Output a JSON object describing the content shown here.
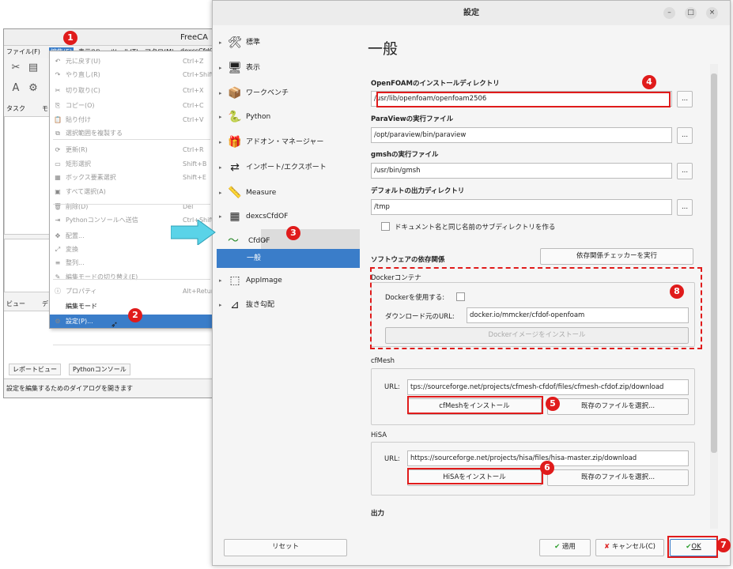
{
  "freecad": {
    "title": "FreeCA",
    "menubar": [
      "ファイル(F)",
      "編集(E)",
      "表示(V)",
      "ツール(T)",
      "マクロ(M)",
      "dexcsCfdO"
    ],
    "tabs_top": [
      "タスク",
      "モ"
    ],
    "bottom_tabs": [
      "レポートビュー",
      "Pythonコンソール"
    ],
    "left_tabs": [
      "ビュー",
      "デ"
    ],
    "status": "設定を編集するためのダイアログを開きます"
  },
  "edit_menu": {
    "items": [
      {
        "label": "元に戻す(U)",
        "shortcut": "Ctrl+Z",
        "icon": "↶"
      },
      {
        "label": "やり直し(R)",
        "shortcut": "Ctrl+Shift",
        "icon": "↷"
      },
      {
        "label": "切り取り(C)",
        "shortcut": "Ctrl+X",
        "icon": "✂"
      },
      {
        "label": "コピー(O)",
        "shortcut": "Ctrl+C",
        "icon": "⎘"
      },
      {
        "label": "貼り付け",
        "shortcut": "Ctrl+V",
        "icon": "📋"
      },
      {
        "label": "選択範囲を複製する",
        "shortcut": "",
        "icon": "⧉"
      },
      {
        "label": "更新(R)",
        "shortcut": "Ctrl+R",
        "icon": "⟳"
      },
      {
        "label": "矩形選択",
        "shortcut": "Shift+B",
        "icon": "▭"
      },
      {
        "label": "ボックス要素選択",
        "shortcut": "Shift+E",
        "icon": "▦"
      },
      {
        "label": "すべて選択(A)",
        "shortcut": "",
        "icon": "▣"
      },
      {
        "label": "削除(D)",
        "shortcut": "Del",
        "icon": "🗑"
      },
      {
        "label": "Pythonコンソールへ送信",
        "shortcut": "Ctrl+Shift",
        "icon": "⇥"
      },
      {
        "label": "配置...",
        "shortcut": "",
        "icon": "✥"
      },
      {
        "label": "変換",
        "shortcut": "",
        "icon": "⤢"
      },
      {
        "label": "整列...",
        "shortcut": "",
        "icon": "≡"
      },
      {
        "label": "編集モードの切り替え(E)",
        "shortcut": "",
        "icon": "✎"
      },
      {
        "label": "プロパティ",
        "shortcut": "Alt+Retur",
        "icon": "ⓘ"
      },
      {
        "label": "編集モード",
        "shortcut": "",
        "icon": ""
      },
      {
        "label": "設定(P)...",
        "shortcut": "",
        "icon": "⚙"
      }
    ]
  },
  "dialog": {
    "title": "設定",
    "nav": [
      {
        "label": "標準",
        "icon": "🛠",
        "arrow": "▸"
      },
      {
        "label": "表示",
        "icon": "🖥",
        "arrow": "▸"
      },
      {
        "label": "ワークベンチ",
        "icon": "📦",
        "arrow": "▸"
      },
      {
        "label": "Python",
        "icon": "🐍",
        "arrow": "▸"
      },
      {
        "label": "アドオン・マネージャー",
        "icon": "🎁",
        "arrow": "▸"
      },
      {
        "label": "インポート/エクスポート",
        "icon": "⇄",
        "arrow": "▸"
      },
      {
        "label": "Measure",
        "icon": "📏",
        "arrow": "▸"
      },
      {
        "label": "dexcsCfdOF",
        "icon": "▦",
        "arrow": "▸"
      },
      {
        "label": "CfdOF",
        "icon": "〜",
        "arrow": "▾"
      },
      {
        "label": "一般",
        "icon": "",
        "arrow": ""
      },
      {
        "label": "AppImage",
        "icon": "⬚",
        "arrow": "▸"
      },
      {
        "label": "抜き勾配",
        "icon": "⊿",
        "arrow": "▸"
      }
    ],
    "reset_label": "リセット",
    "page_title": "一般",
    "openfoam_label": "OpenFOAMのインストールディレクトリ",
    "openfoam_value": "/usr/lib/openfoam/openfoam2506",
    "paraview_label": "ParaViewの実行ファイル",
    "paraview_value": "/opt/paraview/bin/paraview",
    "gmsh_label": "gmshの実行ファイル",
    "gmsh_value": "/usr/bin/gmsh",
    "outdir_label": "デフォルトの出力ディレクトリ",
    "outdir_value": "/tmp",
    "subdir_label": "ドキュメント名と同じ名前のサブディレクトリを作る",
    "deps_label": "ソフトウェアの依存関係",
    "deps_button": "依存関係チェッカーを実行",
    "docker_group": "Dockerコンテナ",
    "docker_use_label": "Dockerを使用する:",
    "docker_url_label": "ダウンロード元のURL:",
    "docker_url_value": "docker.io/mmcker/cfdof-openfoam",
    "docker_install": "Dockerイメージをインストール",
    "cfmesh_group": "cfMesh",
    "url_label": "URL:",
    "cfmesh_url": "tps://sourceforge.net/projects/cfmesh-cfdof/files/cfmesh-cfdof.zip/download",
    "cfmesh_install": "cfMeshをインストール",
    "choose_file": "既存のファイルを選択...",
    "hisa_group": "HiSA",
    "hisa_url": "https://sourceforge.net/projects/hisa/files/hisa-master.zip/download",
    "hisa_install": "HiSAをインストール",
    "output_label": "出力",
    "browse": "...",
    "apply": "適用",
    "cancel": "キャンセル(C)",
    "ok": "OK"
  },
  "badges": [
    "1",
    "2",
    "3",
    "4",
    "5",
    "6",
    "7",
    "8"
  ],
  "colors": {
    "accent": "#3a7dc9",
    "annotation": "#e01b1b",
    "arrow": "#5ad3e8"
  }
}
